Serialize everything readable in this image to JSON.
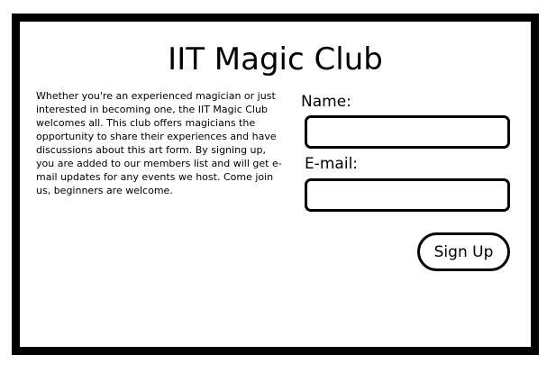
{
  "page": {
    "title": "IIT Magic Club",
    "description": "Whether you're an experienced magician or just interested in becoming one, the IIT Magic Club welcomes all. This club offers magicians the opportunity to share their experiences and have discussions about this art form. By signing up, you are added to our members list and will get e-mail updates for any events we host. Come join us, beginners are welcome."
  },
  "form": {
    "name_label": "Name:",
    "name_value": "",
    "email_label": "E-mail:",
    "email_value": "",
    "submit_label": "Sign Up"
  },
  "colors": {
    "border": "#000000",
    "background": "#ffffff",
    "text": "#000000"
  }
}
